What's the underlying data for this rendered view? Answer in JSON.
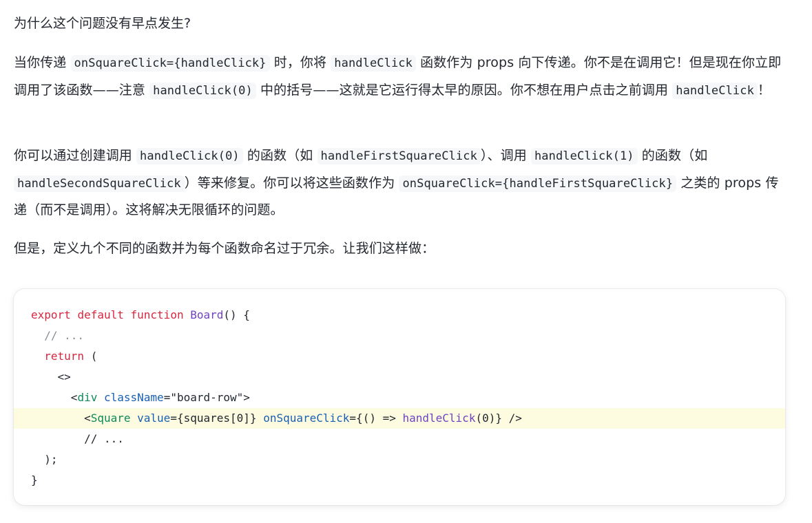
{
  "heading": "为什么这个问题没有早点发生?",
  "paragraph1": {
    "t1": "当你传递 ",
    "c1": "onSquareClick={handleClick}",
    "t2": " 时，你将 ",
    "c2": "handleClick",
    "t3": " 函数作为 props 向下传递。你不是在调用它！但是现在你立即调用了该函数——注意 ",
    "c3": "handleClick(0)",
    "t4": " 中的括号——这就是它运行得太早的原因。你不想在用户点击之前调用 ",
    "c4": "handleClick",
    "t5": "！"
  },
  "paragraph2": {
    "t1": "你可以通过创建调用 ",
    "c1": "handleClick(0)",
    "t2": " 的函数（如 ",
    "c2": "handleFirstSquareClick",
    "t3": "）、调用 ",
    "c3": "handleClick(1)",
    "t4": " 的函数（如 ",
    "c4": "handleSecondSquareClick",
    "t5": "）等来修复。你可以将这些函数作为 ",
    "c5": "onSquareClick={handleFirstSquareClick}",
    "t6": " 之类的 props 传递（而不是调用）。这将解决无限循环的问题。"
  },
  "paragraph3": "但是，定义九个不同的函数并为每个函数命名过于冗余。让我们这样做：",
  "code": {
    "line1": {
      "kw1": "export",
      "kw2": "default",
      "kw3": "function",
      "name": "Board",
      "rest": "() {"
    },
    "line2": {
      "comment": "// ..."
    },
    "line3": {
      "kw": "return",
      "rest": " ("
    },
    "line4": {
      "text": "<>"
    },
    "line5": {
      "open": "<",
      "tag": "div",
      "attr": "className",
      "eq": "=",
      "value": "\"board-row\"",
      "close": ">"
    },
    "line6": {
      "open": "<",
      "tag": "Square",
      "attr1": "value",
      "val1": "={squares[0]}",
      "attr2": "onSquareClick",
      "val2a": "={() => ",
      "fn": "handleClick",
      "val2b": "(0)} />"
    },
    "line7": {
      "comment": "// ..."
    },
    "line8": {
      "text": ");"
    },
    "line9": {
      "text": "}"
    }
  }
}
